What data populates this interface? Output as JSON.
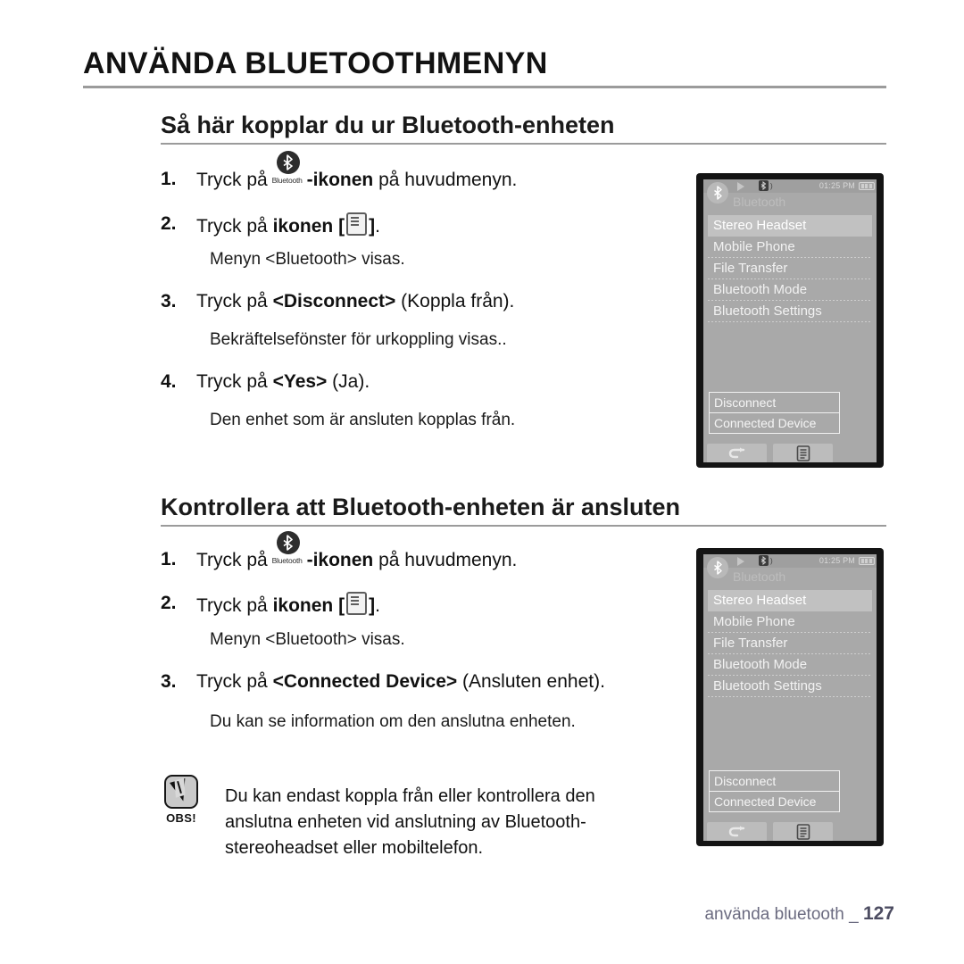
{
  "chapter": {
    "title": "ANVÄNDA BLUETOOTHMENYN"
  },
  "sections": [
    {
      "heading": "Så här kopplar du ur Bluetooth-enheten",
      "steps": [
        {
          "num": "1.",
          "pre": "Tryck på ",
          "icon": "bluetooth-icon",
          "icon_caption": "Bluetooth",
          "bold": "-ikonen",
          "post": " på huvudmenyn."
        },
        {
          "num": "2.",
          "pre": "Tryck på ",
          "bold": "ikonen [",
          "glyph": "menu-key-icon",
          "post_bold": "]",
          "post": "."
        },
        {
          "sub": "Menyn <Bluetooth> visas."
        },
        {
          "num": "3.",
          "pre": "Tryck på ",
          "bold": "<Disconnect>",
          "post": " (Koppla från)."
        },
        {
          "sub": "Bekräftelsefönster för urkoppling visas.."
        },
        {
          "num": "4.",
          "pre": "Tryck på ",
          "bold": "<Yes>",
          "post": " (Ja)."
        },
        {
          "sub": "Den enhet som är ansluten kopplas från."
        }
      ]
    },
    {
      "heading": "Kontrollera att Bluetooth-enheten är ansluten",
      "steps": [
        {
          "num": "1.",
          "pre": "Tryck på ",
          "icon": "bluetooth-icon",
          "icon_caption": "Bluetooth",
          "bold": "-ikonen",
          "post": " på huvudmenyn."
        },
        {
          "num": "2.",
          "pre": "Tryck på ",
          "bold": "ikonen [",
          "glyph": "menu-key-icon",
          "post_bold": "]",
          "post": "."
        },
        {
          "sub": "Menyn <Bluetooth> visas."
        },
        {
          "num": "3.",
          "pre": "Tryck på ",
          "bold": "<Connected Device>",
          "post": " (Ansluten enhet)."
        },
        {
          "sub": "Du kan se information om den anslutna enheten."
        }
      ]
    }
  ],
  "note": {
    "label": "OBS!",
    "icon": "note-pen-icon",
    "lines": [
      "Du kan endast koppla från eller kontrollera den",
      "anslutna enheten vid anslutning av Bluetooth-",
      "stereoheadset eller mobiltelefon."
    ]
  },
  "device_screen": {
    "status": {
      "play_icon": "play-icon",
      "bluetooth_icon": "bluetooth-audio-icon",
      "time": "01:25 PM",
      "battery_icon": "battery-full-icon"
    },
    "title": "Bluetooth",
    "badge_icon": "bluetooth-icon",
    "menu_items": [
      {
        "label": "Stereo Headset",
        "selected": true
      },
      {
        "label": "Mobile Phone",
        "selected": false
      },
      {
        "label": "File Transfer",
        "selected": false
      },
      {
        "label": "Bluetooth Mode",
        "selected": false
      },
      {
        "label": "Bluetooth Settings",
        "selected": false
      }
    ],
    "context_menu": [
      {
        "label": "Disconnect"
      },
      {
        "label": "Connected Device"
      }
    ],
    "softkeys": [
      {
        "icon": "back-arrow-icon"
      },
      {
        "icon": "menu-key-icon"
      }
    ]
  },
  "footer": {
    "text": "använda bluetooth _",
    "page": "127"
  },
  "colors": {
    "rule": "#9b9b9b",
    "screen_bg": "#a9a9a9",
    "screen_frame": "#141414",
    "selected_row": "#c1c1c1",
    "footer_text": "#6b6b80"
  }
}
